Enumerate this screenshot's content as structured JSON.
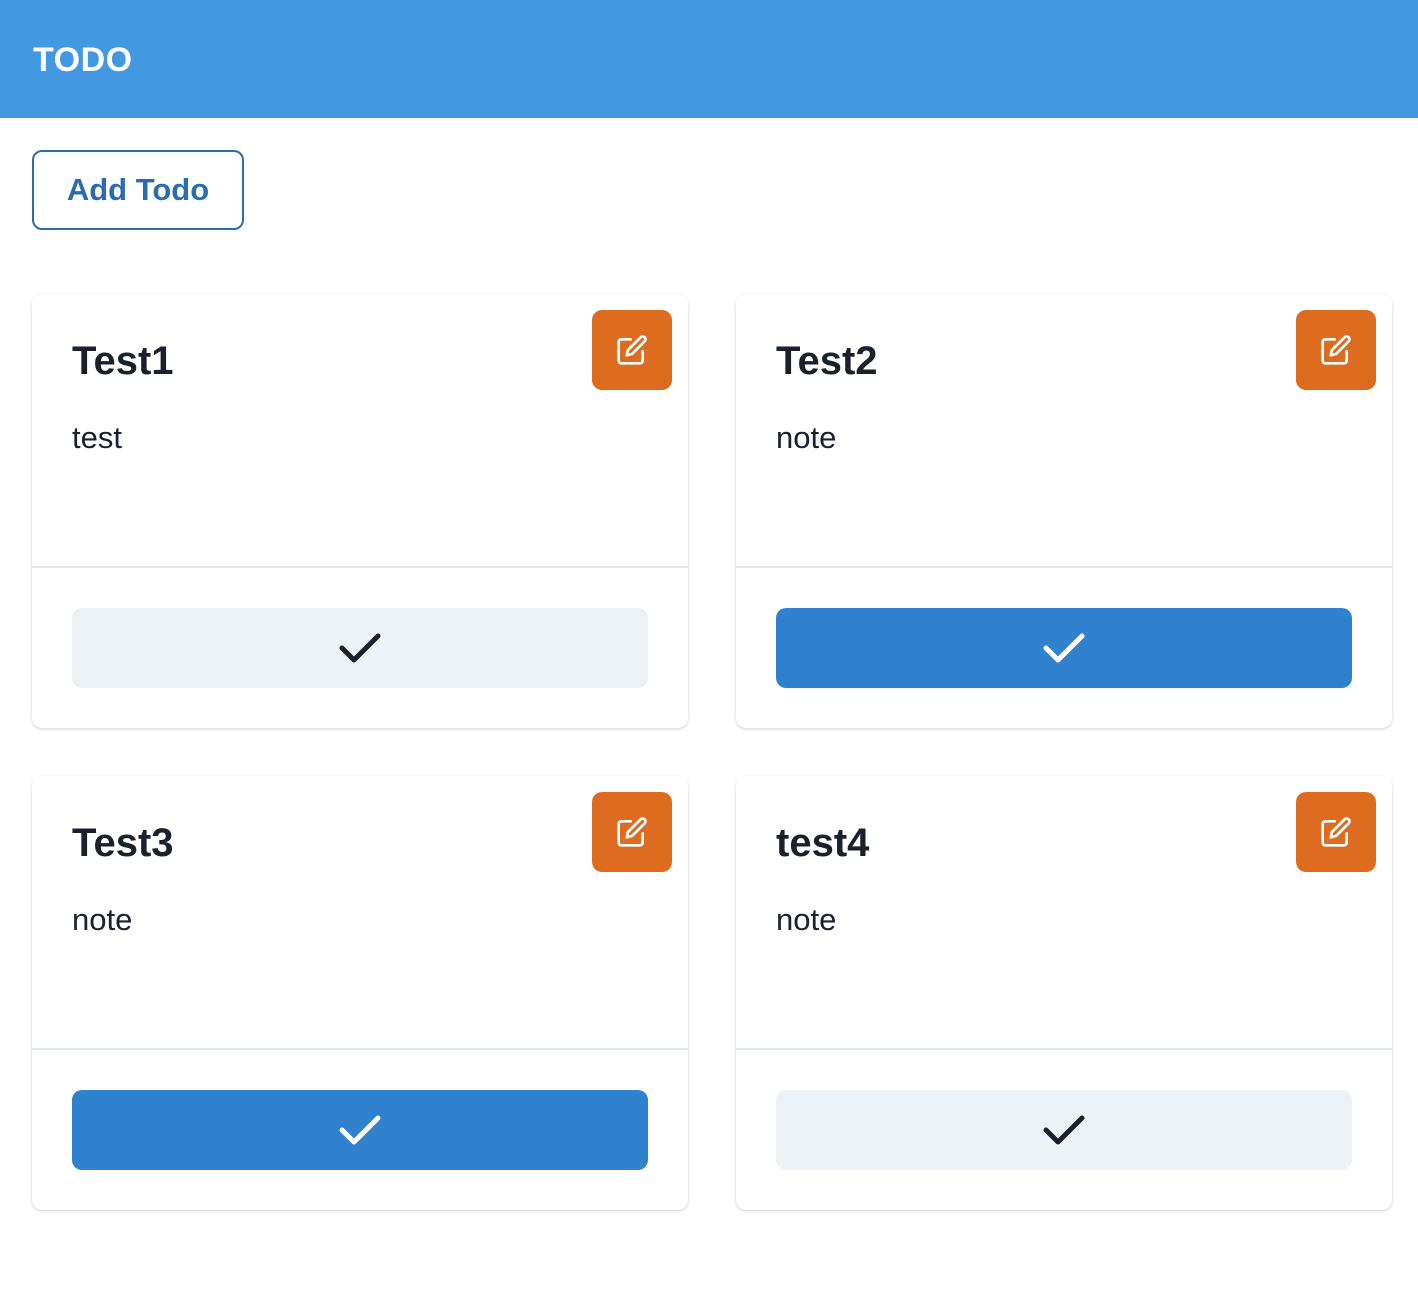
{
  "header": {
    "title": "TODO",
    "background": "#4299e1"
  },
  "toolbar": {
    "add_label": "Add Todo"
  },
  "todos": [
    {
      "title": "Test1",
      "note": "test",
      "done": false,
      "edit_icon": "edit-icon",
      "check_icon": "check-icon"
    },
    {
      "title": "Test2",
      "note": "note",
      "done": true,
      "edit_icon": "edit-icon",
      "check_icon": "check-icon"
    },
    {
      "title": "Test3",
      "note": "note",
      "done": true,
      "edit_icon": "edit-icon",
      "check_icon": "check-icon"
    },
    {
      "title": "test4",
      "note": "note",
      "done": false,
      "edit_icon": "edit-icon",
      "check_icon": "check-icon"
    }
  ],
  "colors": {
    "accent": "#2b6cb0",
    "edit": "#dd6b20",
    "done_active": "#3182ce",
    "done_inactive": "#edf2f7"
  }
}
